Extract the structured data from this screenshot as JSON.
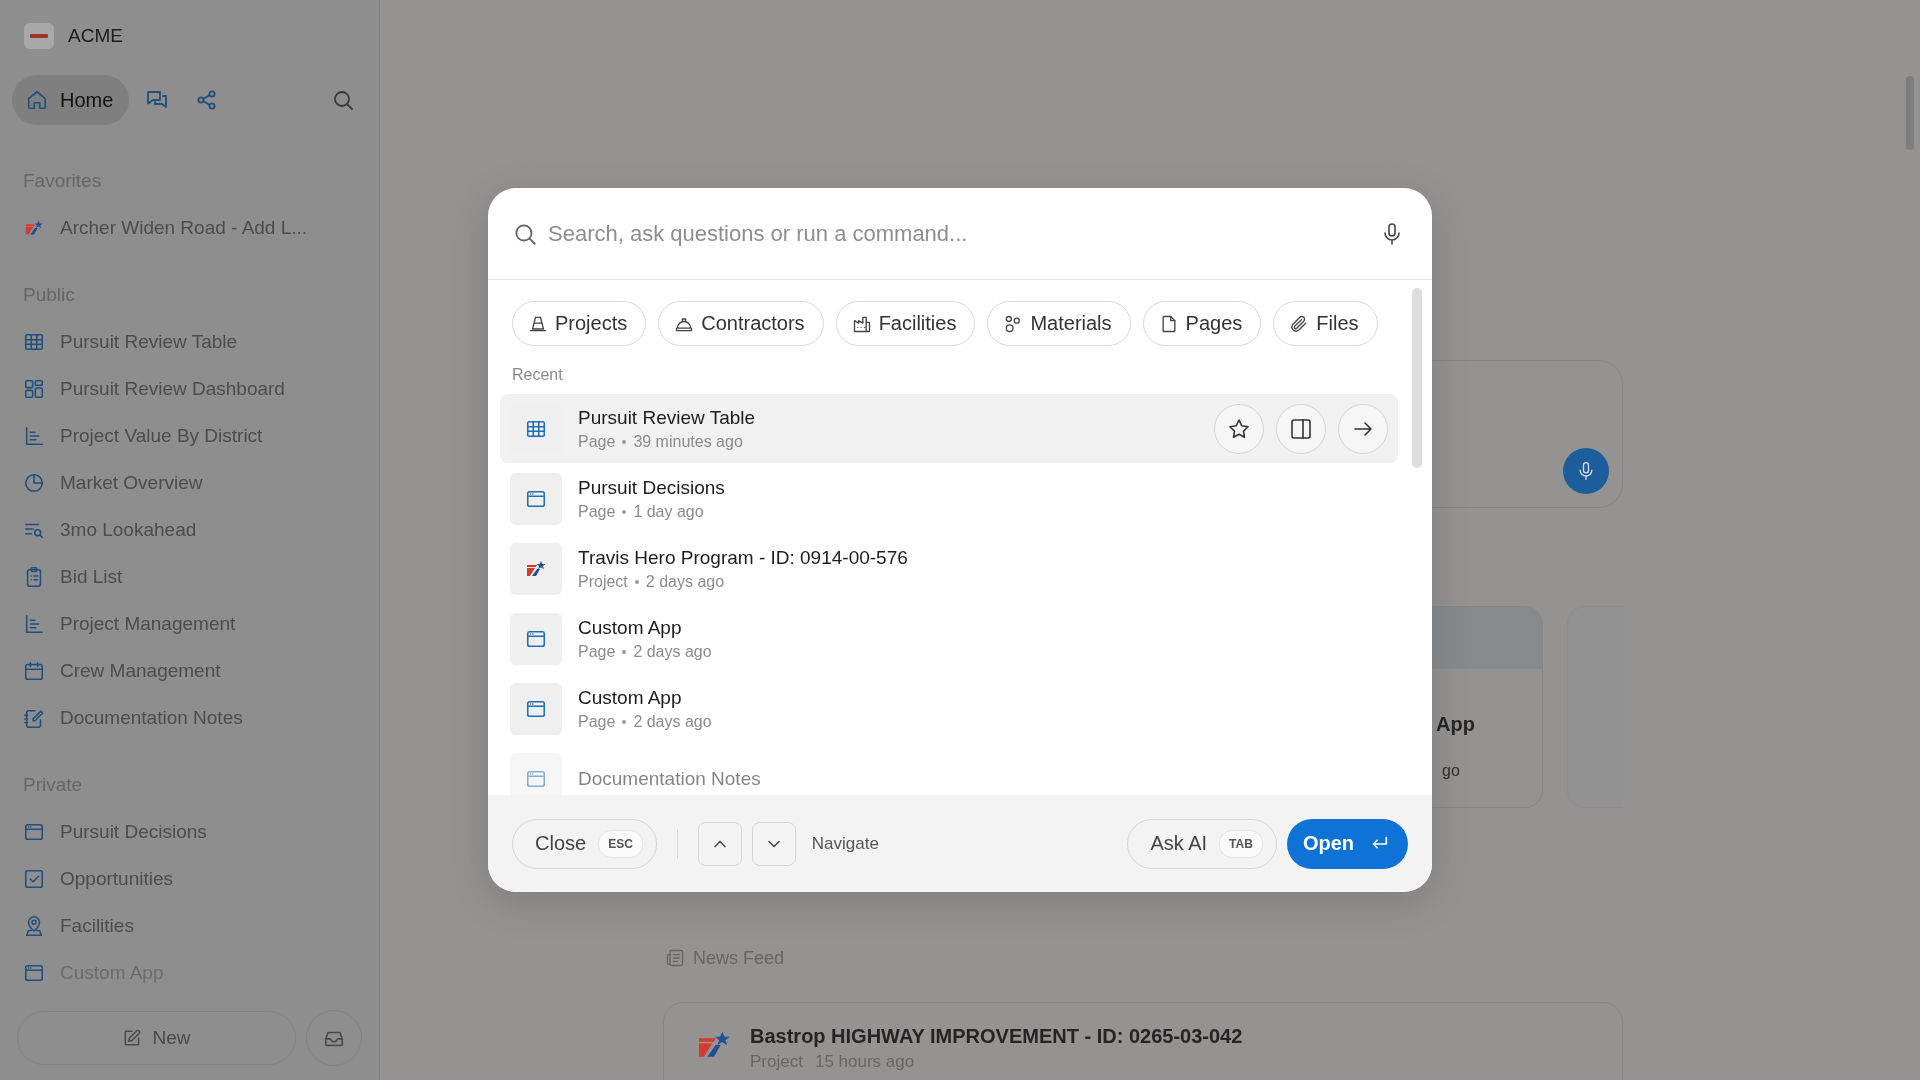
{
  "sidebar": {
    "brand": "ACME",
    "nav": [
      {
        "label": "Home",
        "selected": true
      }
    ],
    "sections": [
      {
        "title": "Favorites",
        "items": [
          {
            "label": "Archer Widen Road - Add L..."
          }
        ]
      },
      {
        "title": "Public",
        "items": [
          {
            "label": "Pursuit Review Table"
          },
          {
            "label": "Pursuit Review Dashboard"
          },
          {
            "label": "Project Value By District"
          },
          {
            "label": "Market Overview"
          },
          {
            "label": "3mo Lookahead"
          },
          {
            "label": "Bid List"
          },
          {
            "label": "Project Management"
          },
          {
            "label": "Crew Management"
          },
          {
            "label": "Documentation Notes"
          }
        ]
      },
      {
        "title": "Private",
        "items": [
          {
            "label": "Pursuit Decisions"
          },
          {
            "label": "Opportunities"
          },
          {
            "label": "Facilities"
          },
          {
            "label": "Custom App"
          }
        ]
      }
    ],
    "new_button": "New"
  },
  "main": {
    "cards": [
      {
        "title": "App",
        "meta": "go"
      }
    ],
    "news_feed": {
      "title": "News Feed",
      "items": [
        {
          "title": "Bastrop HIGHWAY IMPROVEMENT - ID: 0265-03-042",
          "type": "Project",
          "time": "15 hours ago"
        }
      ]
    }
  },
  "palette": {
    "search": {
      "placeholder": "Search, ask questions or run a command..."
    },
    "filters": [
      {
        "label": "Projects"
      },
      {
        "label": "Contractors"
      },
      {
        "label": "Facilities"
      },
      {
        "label": "Materials"
      },
      {
        "label": "Pages"
      },
      {
        "label": "Files"
      }
    ],
    "recent_label": "Recent",
    "recent": [
      {
        "kind": "table",
        "title": "Pursuit Review Table",
        "type": "Page",
        "time": "39 minutes ago",
        "selected": true
      },
      {
        "kind": "page",
        "title": "Pursuit Decisions",
        "type": "Page",
        "time": "1 day ago",
        "selected": false
      },
      {
        "kind": "project",
        "title": "Travis Hero Program - ID: 0914-00-576",
        "type": "Project",
        "time": "2 days ago",
        "selected": false
      },
      {
        "kind": "page",
        "title": "Custom App",
        "type": "Page",
        "time": "2 days ago",
        "selected": false
      },
      {
        "kind": "page",
        "title": "Custom App",
        "type": "Page",
        "time": "2 days ago",
        "selected": false
      },
      {
        "kind": "page",
        "title": "Documentation Notes",
        "selected": false
      }
    ],
    "footer": {
      "close": {
        "label": "Close",
        "shortcut": "ESC"
      },
      "navigate": "Navigate",
      "ask_ai": {
        "label": "Ask AI",
        "shortcut": "TAB"
      },
      "open": {
        "label": "Open"
      }
    }
  }
}
